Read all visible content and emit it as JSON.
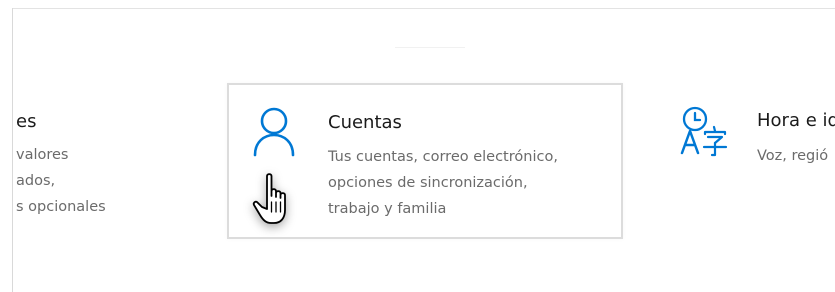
{
  "settings_tiles": [
    {
      "title": "es",
      "description": [
        "valores",
        "ados,",
        "s opcionales"
      ],
      "icon": "partial-tile-icon"
    },
    {
      "title": "Cuentas",
      "description": [
        "Tus cuentas, correo electrónico,",
        "opciones de sincronización,",
        "trabajo y familia"
      ],
      "icon": "user-account-icon",
      "selected": true
    },
    {
      "title": "Hora e id",
      "description": [
        "Voz, regió"
      ],
      "icon": "time-language-icon"
    }
  ],
  "cursor": {
    "icon": "hand-pointer-icon"
  },
  "colors": {
    "accent": "#0078d4",
    "title_text": "#1a1a1a",
    "description_text": "#6b6b6b",
    "tile_border": "#dcdcdc"
  }
}
